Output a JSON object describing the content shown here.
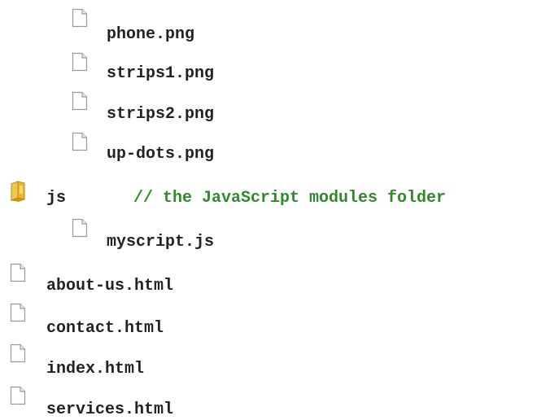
{
  "tree": {
    "images_children": [
      {
        "name": "phone.png"
      },
      {
        "name": "strips1.png"
      },
      {
        "name": "strips2.png"
      },
      {
        "name": "up-dots.png"
      }
    ],
    "js_folder": {
      "name": "js",
      "comment": "// the JavaScript modules folder",
      "children": [
        {
          "name": "myscript.js"
        }
      ]
    },
    "root_files": [
      {
        "name": "about-us.html"
      },
      {
        "name": "contact.html"
      },
      {
        "name": "index.html"
      },
      {
        "name": "services.html"
      }
    ]
  },
  "icons": {
    "file": "file-icon",
    "folder": "folder-icon"
  },
  "colors": {
    "text": "#222222",
    "comment": "#2f8a2a",
    "folder": "#e8b830"
  }
}
